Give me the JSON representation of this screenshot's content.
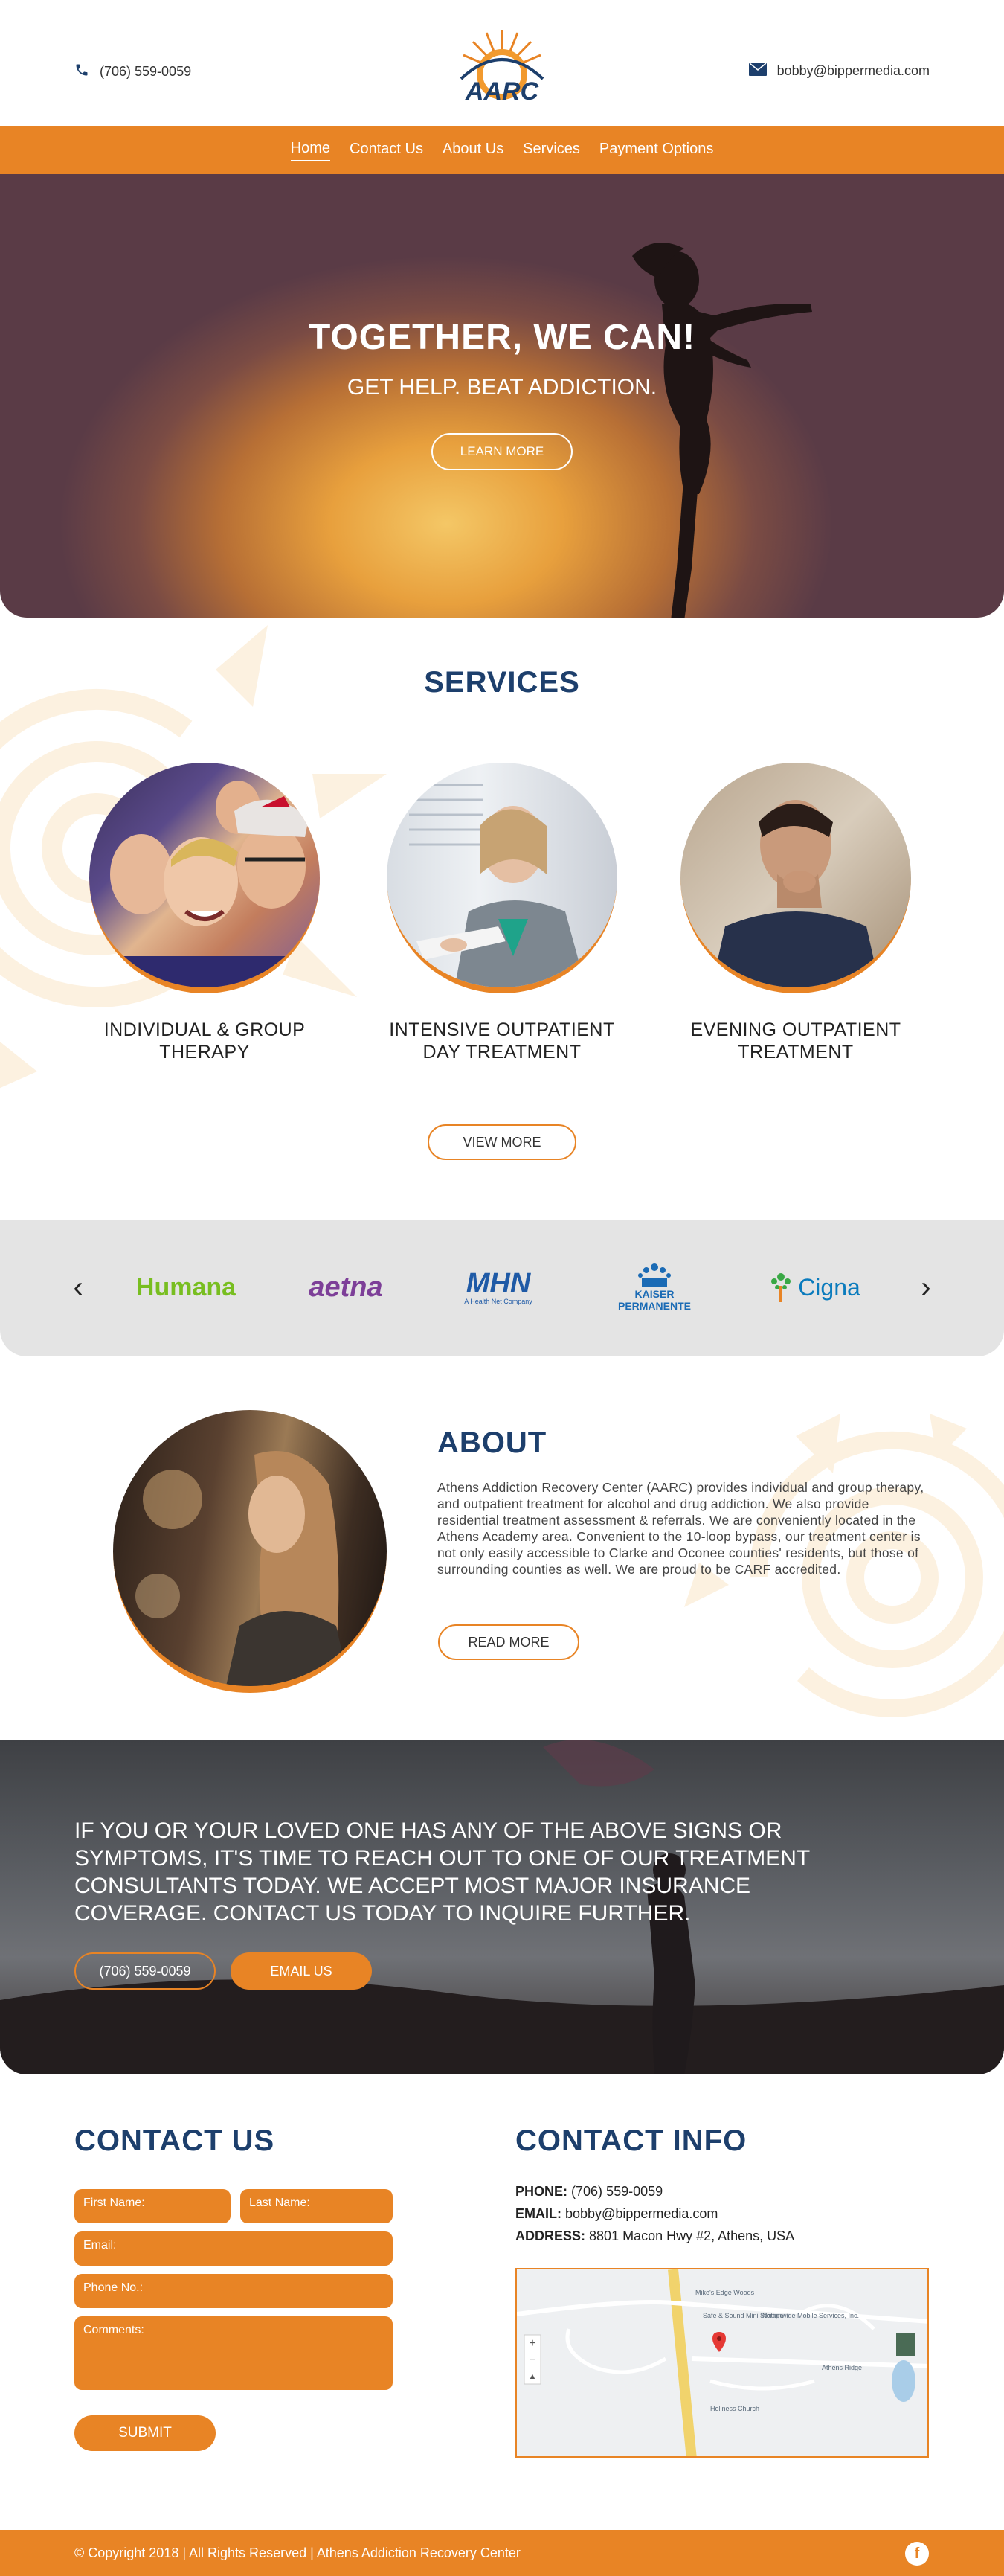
{
  "header": {
    "phone": "(706) 559-0059",
    "email": "bobby@bippermedia.com",
    "logo_text": "AARC"
  },
  "nav": {
    "items": [
      {
        "label": "Home",
        "active": true
      },
      {
        "label": "Contact Us"
      },
      {
        "label": "About Us"
      },
      {
        "label": "Services"
      },
      {
        "label": "Payment Options"
      }
    ]
  },
  "hero": {
    "title": "TOGETHER, WE CAN!",
    "subtitle": "GET HELP. BEAT ADDICTION.",
    "button": "LEARN MORE"
  },
  "services": {
    "title": "SERVICES",
    "items": [
      {
        "label": "INDIVIDUAL & GROUP THERAPY"
      },
      {
        "label": "INTENSIVE OUTPATIENT DAY TREATMENT"
      },
      {
        "label": "EVENING OUTPATIENT TREATMENT"
      }
    ],
    "button": "VIEW MORE"
  },
  "insurance": {
    "logos": [
      {
        "name": "Humana",
        "color": "#78be20"
      },
      {
        "name": "aetna",
        "color": "#7d3f98"
      },
      {
        "name": "MHN",
        "sub": "A Health Net Company",
        "color": "#1f5aa6"
      },
      {
        "name": "KAISER PERMANENTE",
        "color": "#1b6bb5"
      },
      {
        "name": "Cigna",
        "color": "#0a7bbd"
      }
    ],
    "prev_icon": "chevron-left-icon",
    "next_icon": "chevron-right-icon"
  },
  "about": {
    "title": "ABOUT",
    "text": "Athens Addiction Recovery Center (AARC) provides individual and group therapy, and outpatient treatment for alcohol and drug addiction. We also provide residential treatment assessment & referrals.  We are conveniently located in the Athens Academy area. Convenient to the 10-loop bypass, our treatment center is not only easily accessible to Clarke and Oconee counties' residents, but those of surrounding counties as well.  We are proud to be CARF accredited.",
    "button": "READ MORE"
  },
  "cta": {
    "text": "IF YOU OR YOUR LOVED ONE HAS ANY OF THE ABOVE SIGNS OR SYMPTOMS, IT'S TIME TO REACH OUT TO ONE OF OUR TREATMENT CONSULTANTS TODAY.  WE ACCEPT MOST MAJOR INSURANCE COVERAGE. CONTACT US TODAY TO INQUIRE FURTHER.",
    "phone_button": "(706) 559-0059",
    "email_button": "EMAIL US"
  },
  "contact": {
    "title": "CONTACT US",
    "first_name": "First Name:",
    "last_name": "Last Name:",
    "email": "Email:",
    "phone": "Phone No.:",
    "comments": "Comments:",
    "submit": "SUBMIT"
  },
  "contact_info": {
    "title": "CONTACT INFO",
    "phone_label": "PHONE:",
    "phone": "(706) 559-0059",
    "email_label": "EMAIL:",
    "email": "bobby@bippermedia.com",
    "address_label": "ADDRESS:",
    "address": "8801 Macon Hwy #2, Athens, USA"
  },
  "map": {
    "labels": [
      "Mike's Edge Woods",
      "Safe & Sound Mini Storage",
      "Nationwide Mobile Services, Inc.",
      "Athens Ridge",
      "Holiness Church"
    ]
  },
  "footer": {
    "copyright": "© Copyright 2018 | All Rights Reserved | Athens Addiction Recovery Center",
    "social_icon": "facebook-icon",
    "social_glyph": "f"
  },
  "colors": {
    "accent": "#e88425",
    "heading": "#1d3f6c"
  }
}
